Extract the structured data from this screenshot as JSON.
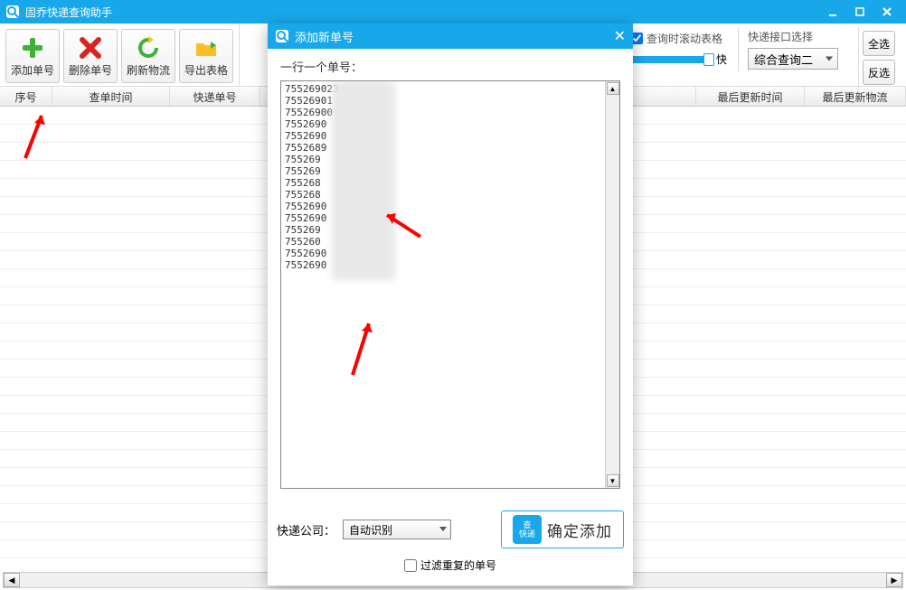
{
  "titlebar": {
    "title": "固乔快递查询助手"
  },
  "toolbar": {
    "add": "添加单号",
    "delete": "删除单号",
    "refresh": "刷新物流",
    "export": "导出表格",
    "scroll_check": "查询时滚动表格",
    "fast": "快",
    "iface_label": "快递接口选择",
    "iface_value": "综合查询二",
    "select_all": "全选",
    "invert": "反选"
  },
  "headers": {
    "seq": "序号",
    "query_time": "查单时间",
    "tracking": "快递单号",
    "last_update": "最后更新时间",
    "last_logistics": "最后更新物流"
  },
  "modal": {
    "title": "添加新单号",
    "hint": "一行一个单号：",
    "numbers": [
      "755269023",
      "75526901",
      "75526900",
      "7552690",
      "7552690",
      "7552689",
      "755269",
      "755269",
      "755268",
      "755268",
      "7552690",
      "7552690",
      "755269",
      "755260",
      "7552690",
      "7552690"
    ],
    "company_label": "快递公司：",
    "company_value": "自动识别",
    "confirm": "确定添加",
    "filter_dup": "过滤重复的单号",
    "qicon_top": "查",
    "qicon_bot": "快递"
  }
}
